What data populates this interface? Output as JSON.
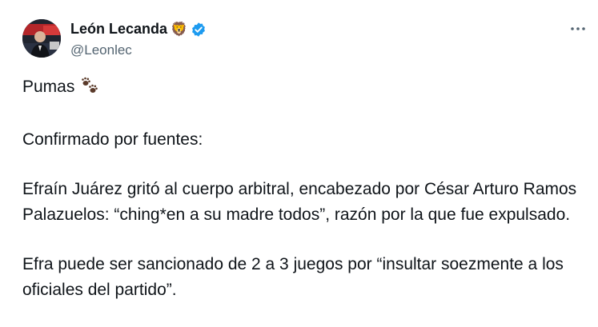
{
  "author": {
    "name": "León Lecanda",
    "name_emoji": "🦁",
    "handle": "@Leonlec",
    "verified_icon": "verified-badge-icon",
    "avatar_icon": "profile-photo"
  },
  "menu_icon": "more-options-icon",
  "tweet": {
    "line1": "Pumas",
    "line1_icon": "paw-prints-icon",
    "p2": "Confirmado por fuentes:",
    "p3": "Efraín Juárez gritó al cuerpo arbitral, encabezado por César Arturo Ramos Palazuelos: “ching*en a su madre todos”, razón por la que fue expulsado.",
    "p4": "Efra puede ser sancionado de 2 a 3 juegos por “insultar soezmente a los oficiales del partido”."
  },
  "colors": {
    "text": "#0f1419",
    "secondary": "#536471",
    "verified": "#1d9bf0"
  }
}
